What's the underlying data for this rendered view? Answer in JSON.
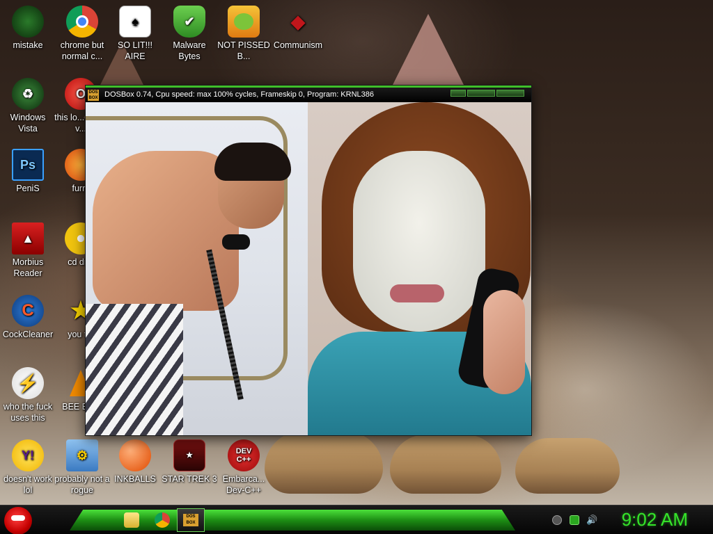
{
  "desktop_icons": [
    {
      "label": "mistake",
      "icon": "green-orb-icon"
    },
    {
      "label": "chrome but normal c...",
      "icon": "chrome-icon"
    },
    {
      "label": "SO LIT!!! AIRE",
      "icon": "solitaire-cards-icon"
    },
    {
      "label": "Malware Bytes",
      "icon": "shield-check-icon"
    },
    {
      "label": "NOT PISSED B...",
      "icon": "angry-birds-pig-icon"
    },
    {
      "label": "Communism",
      "icon": "red-emblem-icon"
    },
    {
      "label": "Windows Vista",
      "icon": "recycle-orb-icon"
    },
    {
      "label": "this lo... like a v...",
      "icon": "opera-icon"
    },
    {
      "label": "PeniS",
      "icon": "photoshop-icon"
    },
    {
      "label": "furry",
      "icon": "firefox-icon"
    },
    {
      "label": "Morbius Reader",
      "icon": "pdf-reader-icon"
    },
    {
      "label": "cd dr...",
      "icon": "cd-drive-icon"
    },
    {
      "label": "CockCleaner",
      "icon": "ccleaner-icon"
    },
    {
      "label": "you t...",
      "icon": "star-icon"
    },
    {
      "label": "who the fuck uses this",
      "icon": "lightning-icon"
    },
    {
      "label": "BEE BEE",
      "icon": "vlc-cone-icon"
    },
    {
      "label": "doesn't work lol",
      "icon": "yahoo-messenger-icon"
    },
    {
      "label": "probably not a rogue",
      "icon": "settings-monitor-icon"
    },
    {
      "label": "INKBALLS",
      "icon": "inkball-icon"
    },
    {
      "label": "STAR TREK 3",
      "icon": "star-trek-icon"
    },
    {
      "label": "Embarca... Dev-C++",
      "icon": "devcpp-icon"
    }
  ],
  "dos_window": {
    "title": "DOSBox 0.74, Cpu speed: max 100% cycles, Frameskip  0, Program:  KRNL386",
    "icon_text": "DOS BOX"
  },
  "taskbar": {
    "clock": "9:02 AM",
    "active_label": "DOS BOX"
  },
  "colors": {
    "accent": "#3fbf2a",
    "clock": "#35e52a"
  }
}
